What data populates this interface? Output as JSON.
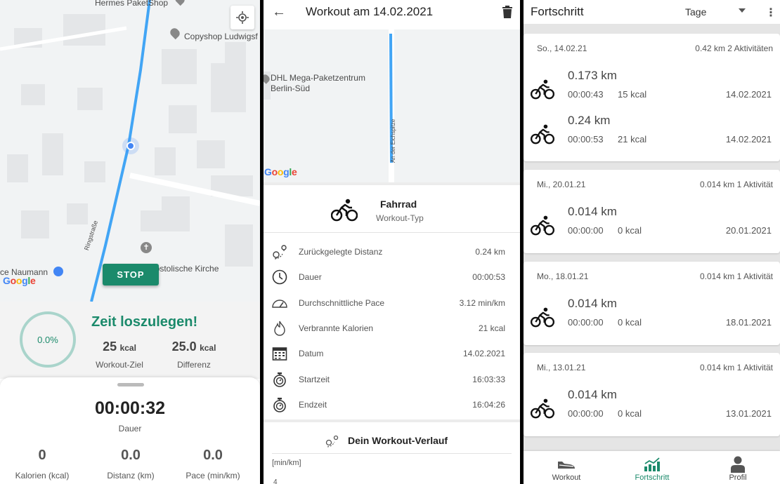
{
  "live": {
    "map": {
      "label_paketshop": "Hermes PaketShop",
      "label_copyshop": "Copyshop Ludwigsf",
      "label_street": "Ringstraße",
      "label_church": "postolische Kirche",
      "label_naumann": "ce Naumann",
      "google_logo": [
        "G",
        "o",
        "o",
        "g",
        "l",
        "e"
      ],
      "stop_label": "STOP"
    },
    "goal": {
      "progress_text": "0.0%",
      "progress": 0.0,
      "headline": "Zeit loszulegen!",
      "target_value": "25",
      "target_unit": "kcal",
      "target_label": "Workout-Ziel",
      "diff_value": "25.0",
      "diff_unit": "kcal",
      "diff_label": "Differenz"
    },
    "timer": {
      "value": "00:00:32",
      "label": "Dauer"
    },
    "stats": [
      {
        "value": "0",
        "label": "Kalorien (kcal)"
      },
      {
        "value": "0.0",
        "label": "Distanz (km)"
      },
      {
        "value": "0.0",
        "label": "Pace (min/km)"
      }
    ]
  },
  "detail": {
    "title": "Workout am 14.02.2021",
    "map": {
      "label_dhl_1": "DHL Mega-Paketzentrum",
      "label_dhl_2": "Berlin-Süd",
      "label_street": "An der Eichspitze"
    },
    "type_name": "Fahrrad",
    "type_sub": "Workout-Typ",
    "rows": [
      {
        "icon": "distance-icon",
        "label": "Zurückgelegte Distanz",
        "value": "0.24  km"
      },
      {
        "icon": "clock-icon",
        "label": "Dauer",
        "value": "00:00:53"
      },
      {
        "icon": "speedometer-icon",
        "label": "Durchschnittliche Pace",
        "value": "3.12  min/km"
      },
      {
        "icon": "flame-icon",
        "label": "Verbrannte Kalorien",
        "value": "21  kcal"
      },
      {
        "icon": "calendar-icon",
        "label": "Datum",
        "value": "14.02.2021"
      },
      {
        "icon": "stopwatch-icon",
        "label": "Startzeit",
        "value": "16:03:33"
      },
      {
        "icon": "stopwatch-icon",
        "label": "Endzeit",
        "value": "16:04:26"
      }
    ],
    "verlauf_title": "Dein Workout-Verlauf",
    "axis_unit": "[min/km]",
    "axis_tick": "4"
  },
  "progress": {
    "title": "Fortschritt",
    "period": "Tage",
    "days": [
      {
        "header": "So., 14.02.21",
        "summary": "0.42 km  2 Aktivitäten",
        "activities": [
          {
            "distance": "0.173 km",
            "duration": "00:00:43",
            "kcal": "15 kcal",
            "date": "14.02.2021"
          },
          {
            "distance": "0.24 km",
            "duration": "00:00:53",
            "kcal": "21 kcal",
            "date": "14.02.2021"
          }
        ]
      },
      {
        "header": "Mi., 20.01.21",
        "summary": "0.014 km  1 Aktivität",
        "activities": [
          {
            "distance": "0.014 km",
            "duration": "00:00:00",
            "kcal": "0 kcal",
            "date": "20.01.2021"
          }
        ]
      },
      {
        "header": "Mo., 18.01.21",
        "summary": "0.014 km  1 Aktivität",
        "activities": [
          {
            "distance": "0.014 km",
            "duration": "00:00:00",
            "kcal": "0 kcal",
            "date": "18.01.2021"
          }
        ]
      },
      {
        "header": "Mi., 13.01.21",
        "summary": "0.014 km  1 Aktivität",
        "activities": [
          {
            "distance": "0.014 km",
            "duration": "00:00:00",
            "kcal": "0 kcal",
            "date": "13.01.2021"
          }
        ]
      }
    ],
    "nav": [
      {
        "label": "Workout",
        "icon": "shoe-icon",
        "active": false
      },
      {
        "label": "Fortschritt",
        "icon": "chart-icon",
        "active": true
      },
      {
        "label": "Profil",
        "icon": "person-icon",
        "active": false
      }
    ]
  },
  "colors": {
    "accent": "#1b8a6b",
    "route": "#42a5f5",
    "ring": "#a9d4cb"
  }
}
